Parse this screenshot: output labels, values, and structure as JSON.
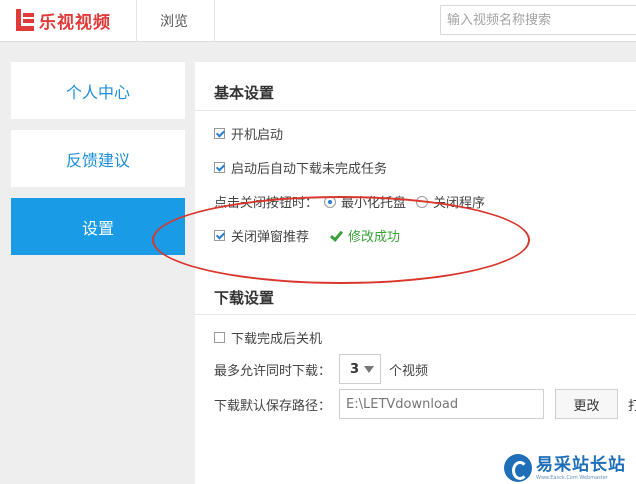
{
  "header": {
    "app_name": "乐视视频",
    "browse_label": "浏览",
    "search_placeholder": "输入视频名称搜索"
  },
  "sidebar": {
    "items": [
      {
        "label": "个人中心"
      },
      {
        "label": "反馈建议"
      },
      {
        "label": "设置"
      }
    ],
    "active_index": 2
  },
  "basic": {
    "title": "基本设置",
    "autostart": {
      "label": "开机启动",
      "checked": true
    },
    "auto_download": {
      "label": "启动后自动下载未完成任务",
      "checked": true
    },
    "close_behavior": {
      "label": "点击关闭按钮时：",
      "options": [
        "最小化托盘",
        "关闭程序"
      ],
      "selected": "最小化托盘"
    },
    "close_popup": {
      "label": "关闭弹窗推荐",
      "checked": true
    },
    "success_message": "修改成功"
  },
  "download": {
    "title": "下载设置",
    "shutdown": {
      "label": "下载完成后关机",
      "checked": false
    },
    "concurrent": {
      "label": "最多允许同时下载：",
      "value": "3",
      "unit": "个视频"
    },
    "save_path": {
      "label": "下载默认保存路径：",
      "value": "E:\\LETVdownload",
      "change_label": "更改",
      "open_label": "打"
    }
  },
  "watermark": {
    "title": "易采站长站",
    "url": "Www.Easck.Com Webmaster"
  },
  "colors": {
    "brand_red": "#e03a3a",
    "accent_blue": "#1a9be6",
    "success_green": "#3aa13a",
    "annotation_red": "#d9362c"
  }
}
